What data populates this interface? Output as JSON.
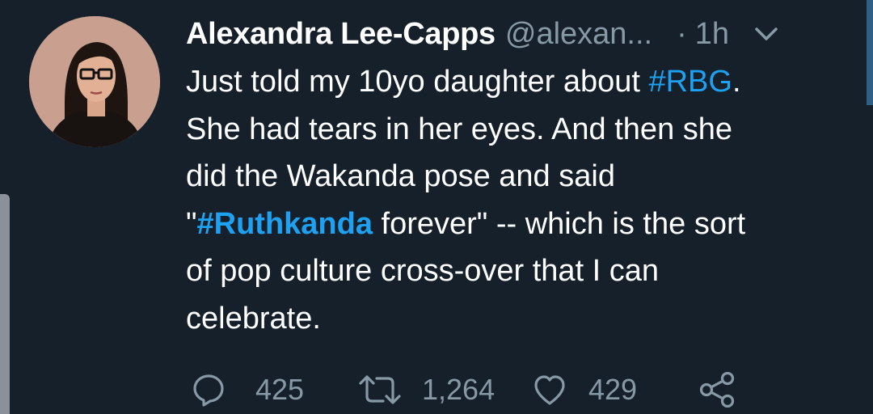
{
  "tweet": {
    "author_name": "Alexandra Lee-Capps",
    "author_handle": "@alexan...",
    "separator": "·",
    "time_ago": "1h",
    "lines": {
      "l1_pre": "Just told my 10yo daughter about ",
      "l1_tag": "#RBG",
      "l1_post": ".",
      "l2": "She had tears in her eyes. And then she",
      "l3": "did the Wakanda pose and said",
      "l4_pre": "\"",
      "l4_tag": "#Ruthkanda",
      "l4_post": " forever\" -- which is the sort",
      "l5": "of pop culture cross-over that I can",
      "l6": "celebrate."
    }
  },
  "actions": {
    "reply_count": "425",
    "retweet_count": "1,264",
    "like_count": "429"
  },
  "icons": {
    "reply": "reply-icon",
    "retweet": "retweet-icon",
    "like": "heart-icon",
    "share": "share-icon",
    "menu": "chevron-down-icon"
  },
  "colors": {
    "background": "#15202b",
    "text": "#ffffff",
    "muted": "#8899a6",
    "link": "#1da1f2"
  }
}
